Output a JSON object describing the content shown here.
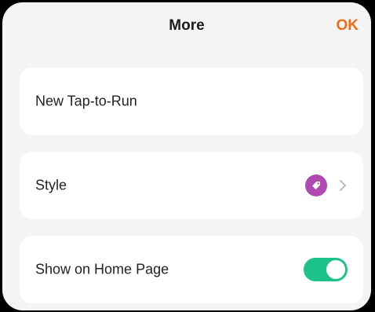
{
  "header": {
    "title": "More",
    "ok_label": "OK"
  },
  "items": [
    {
      "label": "New Tap-to-Run"
    },
    {
      "label": "Style",
      "icon": "tag-icon",
      "icon_color": "#b04ab2"
    },
    {
      "label": "Show on Home Page",
      "toggle_on": true,
      "toggle_color": "#1dc28a"
    }
  ],
  "colors": {
    "accent": "#ef6b16",
    "background": "#f4f4f4",
    "card": "#ffffff"
  }
}
